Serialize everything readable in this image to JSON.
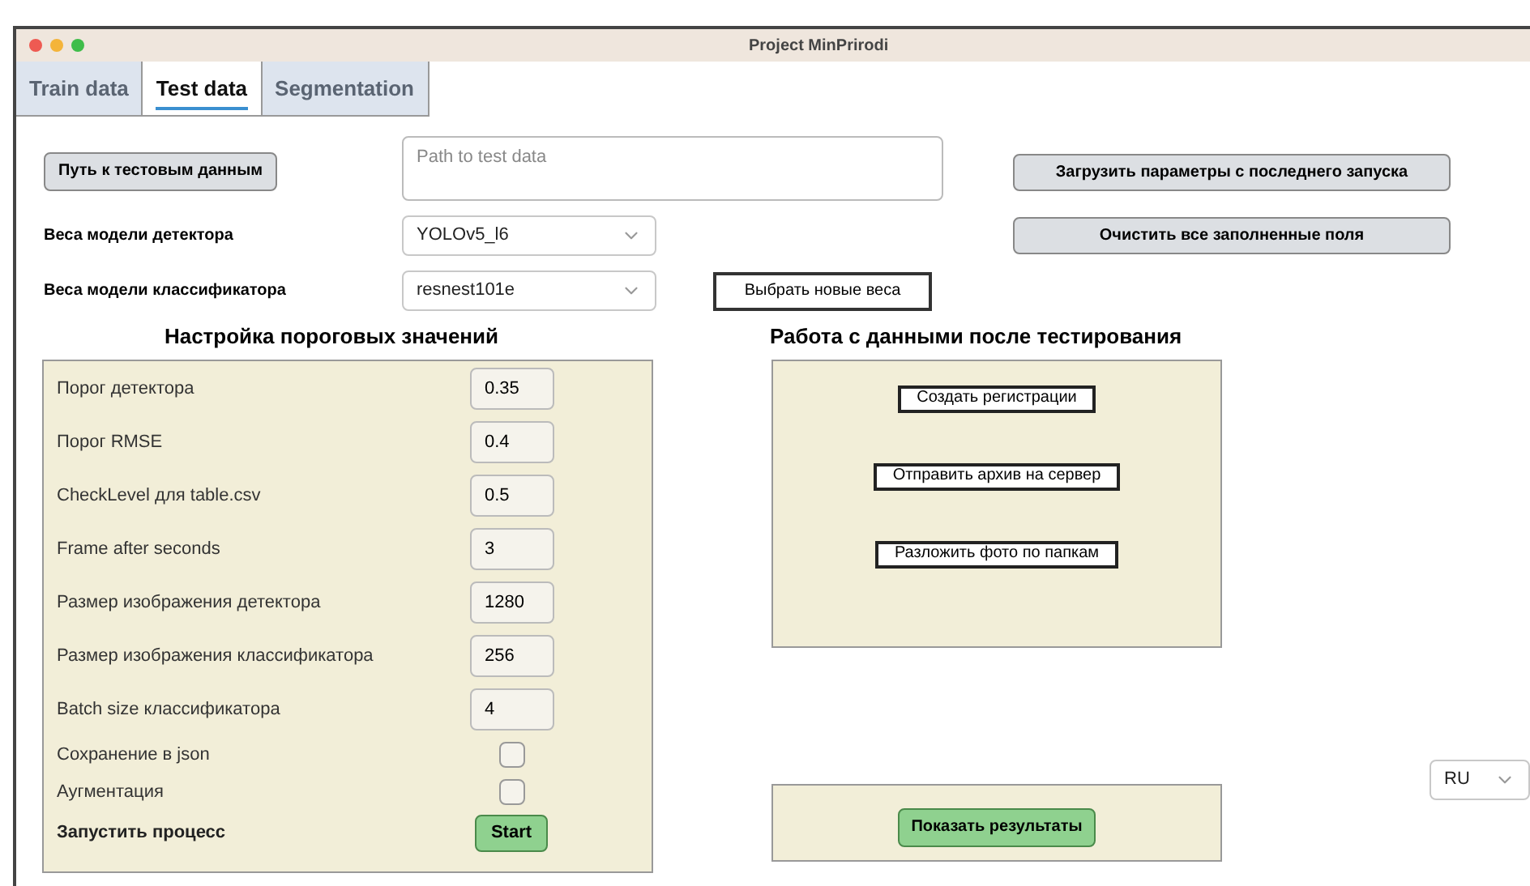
{
  "window": {
    "title": "Project MinPrirodi"
  },
  "tabs": [
    {
      "label": "Train data",
      "selected": false
    },
    {
      "label": "Test data",
      "selected": true
    },
    {
      "label": "Segmentation",
      "selected": false
    }
  ],
  "path_button": "Путь к тестовым данным",
  "path_field": {
    "placeholder": "Path to test data"
  },
  "load_button": "Загрузить параметры с последнего запуска",
  "detector_weights": {
    "label": "Веса модели детектора",
    "value": "YOLOv5_l6"
  },
  "clear_button": "Очистить все заполненные поля",
  "classifier_weights": {
    "label": "Веса модели классификатора",
    "value": "resnest101e"
  },
  "new_weights_button": "Выбрать новые веса",
  "thresholds": {
    "title": "Настройка пороговых значений",
    "rows": [
      {
        "kind": "number",
        "label": "Порог детектора",
        "value": "0.35"
      },
      {
        "kind": "number",
        "label": "Порог RMSE",
        "value": "0.4"
      },
      {
        "kind": "number",
        "label": "CheckLevel для table.csv",
        "value": "0.5"
      },
      {
        "kind": "number",
        "label": "Frame after seconds",
        "value": "3"
      },
      {
        "kind": "number",
        "label": "Размер изображения детектора",
        "value": "1280"
      },
      {
        "kind": "number",
        "label": "Размер изображения классификатора",
        "value": "256"
      },
      {
        "kind": "number",
        "label": "Batch size классификатора",
        "value": "4"
      },
      {
        "kind": "checkbox",
        "label": "Сохранение в json",
        "checked": false
      },
      {
        "kind": "checkbox",
        "label": "Аугментация",
        "checked": false
      },
      {
        "kind": "start",
        "label": "Запустить процесс",
        "button": "Start"
      }
    ]
  },
  "post": {
    "title": "Работа с данными после тестирования",
    "buttons": [
      "Создать регистрации",
      "Отправить архив на сервер",
      "Разложить фото по папкам"
    ]
  },
  "results_button": "Показать результаты",
  "language": {
    "value": "RU"
  }
}
